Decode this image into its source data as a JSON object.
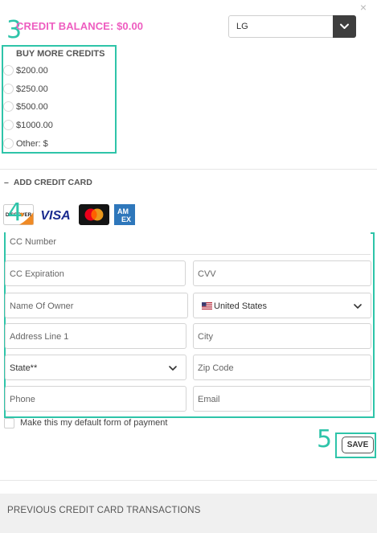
{
  "close_glyph": "×",
  "header": {
    "credit_balance": "CREDIT BALANCE: $0.00",
    "location_select": {
      "value": "LG"
    }
  },
  "buy_credits": {
    "title": "BUY MORE CREDITS",
    "options": [
      "$200.00",
      "$250.00",
      "$500.00",
      "$1000.00",
      "Other: $"
    ]
  },
  "add_credit_card": {
    "title": "ADD CREDIT CARD",
    "toggle": "–",
    "card_logos": [
      "discover-logo",
      "visa-logo",
      "mastercard-logo",
      "amex-logo"
    ],
    "logo_text": {
      "discover": "DISCOVER",
      "visa": "VISA",
      "amex_line1": "AM",
      "amex_line2": "EX"
    }
  },
  "form": {
    "cc_number": "CC Number",
    "cc_expiration": "CC Expiration",
    "cvv": "CVV",
    "name_of_owner": "Name Of Owner",
    "country": "United States",
    "address_line_1": "Address Line 1",
    "city": "City",
    "state": "State**",
    "zip_code": "Zip Code",
    "phone": "Phone",
    "email": "Email"
  },
  "default_payment_label": "Make this my default form of payment",
  "save_label": "SAVE",
  "previous_transactions": "PREVIOUS CREDIT CARD TRANSACTIONS",
  "annotations": {
    "step3": "3",
    "step4": "4",
    "step5": "5"
  },
  "colors": {
    "accent_pink": "#ee5dc0",
    "annotation_teal": "#2ec4a9",
    "dark_button": "#3e3e3e"
  }
}
